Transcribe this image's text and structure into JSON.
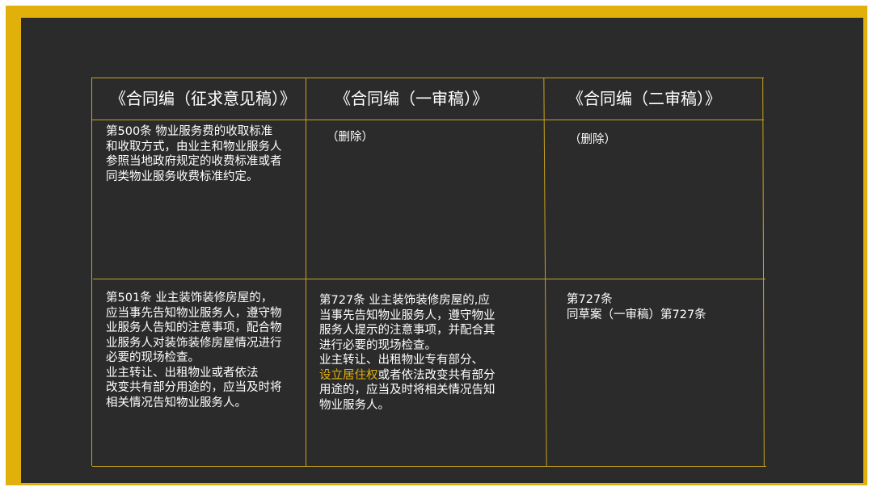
{
  "headers": [
    "《合同编（征求意见稿）》",
    "《合同编（一审稿）》",
    "《合同编（二审稿）》"
  ],
  "row1": {
    "col1": "第500条  物业服务费的收取标准\n和收取方式，由业主和物业服务人\n参照当地政府规定的收费标准或者\n同类物业服务收费标准约定。",
    "col2": "（删除）",
    "col3": "（删除）"
  },
  "row2": {
    "col1": "第501条    业主装饰装修房屋的，\n应当事先告知物业服务人，遵守物\n业服务人告知的注意事项，配合物\n业服务人对装饰装修房屋情况进行\n必要的现场检查。\n        业主转让、出租物业或者依法\n改变共有部分用途的，应当及时将\n相关情况告知物业服务人。",
    "col2_part1": "第727条    业主装饰装修房屋的,应\n当事先告知物业服务人，遵守物业\n服务人提示的注意事项，并配合其\n进行必要的现场检查。\n        业主转让、出租物业专有部分、\n",
    "col2_highlight": "设立居住权",
    "col2_part2": "或者依法改变共有部分\n用途的，应当及时将相关情况告知\n物业服务人。",
    "col3": "第727条\n同草案（一审稿）第727条"
  },
  "colors": {
    "frame": "#e2b00a",
    "background": "#2b2b2b",
    "highlight": "#e2b00a",
    "grid": "#c9a21c"
  }
}
